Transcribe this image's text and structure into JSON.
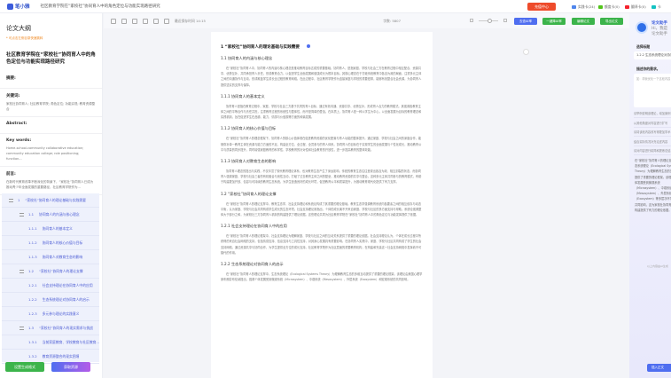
{
  "app": {
    "logo": "笔小雅",
    "doc_title": "社区教育学院在“家校社”协同育人中的角色定位与功能实现路径研究"
  },
  "top": {
    "recharge": "充值中心",
    "badges": [
      {
        "label": "实践卡(24)",
        "color": "#4f86ec"
      },
      {
        "label": "额度卡(0)",
        "color": "#52c41a"
      },
      {
        "label": "翻译卡(0)",
        "color": "#f5222d"
      },
      {
        "label": "卡",
        "color": "#13c2c2"
      }
    ]
  },
  "outline": {
    "title": "论文大纲",
    "hint": "* 可点击左侧目录快速跳转",
    "paper_title": "社区教育学院在“家校社”协同育人中的角色定位与功能实现路径研究",
    "abstract_label": "摘要:",
    "keywords_label": "关键词:",
    "keywords": "家校社协同育人; 社区教育学院; 角色定位; 功能实现; 教育资源整合",
    "abstract_en_label": "Abstract:",
    "keywords_en_label": "Key words:",
    "keywords_en": "Home-school-community collaborative education; community education college; role positioning; function...",
    "intro_label": "前言:",
    "intro": "在新时代教育改革不断深化的背景下，“家校社”协同育人已成为推动青少年全面发展的重要路径，社区教育学院作为...",
    "tree": [
      {
        "num": "1",
        "label": "“家校社”协同育人的理论基础与实践需要",
        "lvl": 1
      },
      {
        "num": "1.1",
        "label": "协同育人的内涵与核心理念",
        "lvl": 2
      },
      {
        "num": "1.1.1",
        "label": "协同育人的基本定义",
        "lvl": 3
      },
      {
        "num": "1.1.2",
        "label": "协同育人的核心价值与目标",
        "lvl": 3
      },
      {
        "num": "1.1.3",
        "label": "协同育人对教育生态的影响",
        "lvl": 3
      },
      {
        "num": "1.2",
        "label": "“家校社”协同育人的理论支撑",
        "lvl": 2
      },
      {
        "num": "1.2.1",
        "label": "社会支持理论在协同育人中的应用",
        "lvl": 3
      },
      {
        "num": "1.2.2",
        "label": "生态系统理论对协同育人的启示",
        "lvl": 3
      },
      {
        "num": "1.2.3",
        "label": "多元参与理论的实践意义",
        "lvl": 3
      },
      {
        "num": "1.3",
        "label": "“家校社”协同育人的现实需求与挑战",
        "lvl": 2
      },
      {
        "num": "1.3.1",
        "label": "当前家庭教育、学校教育与社区教育...",
        "lvl": 3
      },
      {
        "num": "1.3.2",
        "label": "教育资源整合的现实困境",
        "lvl": 3
      }
    ],
    "btn_format": "设置生成格式",
    "btn_resource": "获取资源"
  },
  "toolbar": {
    "saved": "最近保存时间 14:15",
    "wordcount": "字数: 5807",
    "btn_ai": "去查AI率",
    "btn_reduce": "一键降AI率",
    "btn_check": "编辑论文",
    "btn_export": "导出论文"
  },
  "doc": {
    "blocks": [
      {
        "t": "h1",
        "text": "1 “家校社”协同育人的理论基础与实践需要"
      },
      {
        "t": "h3",
        "text": "1.1 协同育人的内涵与核心理念"
      },
      {
        "t": "p",
        "text": "在“家校社”协同育人中，协同育人的内涵与核心理念是推动教育目标达成的重要基础。协同育人，是指家庭、学校与社会三方在教育过程中相互配合、资源共享、优势互补，共同承担育人责任，形成教育合力。以促进学生全面发展和健康成长为根本目标。其核心理念在于打破传统教育中各自为政的局面，注重多元主体之间的沟通协作与互动，形成覆盖学生成长全过程的教育网络。在此过程中，社区教育学院作为连接家庭与学校的重要纽带，能够有效整合社会资源，为协同育人提供坚实的支撑与保障。"
      },
      {
        "t": "h3",
        "text": "1.1.1 协同育人的基本定义"
      },
      {
        "t": "p",
        "text": "协同育人是指在教育过程中，家庭、学校与社会三方基于共同的育人目标，通过有效沟通、资源共享、优势互补，形成育人合力的教育模式。其强调各教育主体之间的平等合作与责任共担，注重教育过程的系统性与整体性，而不是简单的叠加。在本质上，协同育人是一种以学生为中心，以全面发展为目标的教育理念和实践机制，旨在促进学生在品德、能力、情感与价值观等方面的和谐发展。"
      },
      {
        "t": "h3",
        "text": "1.1.2 协同育人的核心价值与目标"
      },
      {
        "t": "p",
        "text": "在“家校社”协同育人的理念框架下，协同育人的核心价值体现在促进教育资源的优化配置与育人功能的整体提升。通过家庭、学校与社会之间的深度合作，能够弥补单一教育主体在资源与能力方面的不足，构建全方位、全过程、全员参与的育人体系。协同育人的目标在于实现学生的全面发展与个性化成长，推动教育公平与质量的同步提升，同时增强家庭教育的科学性、学校教育的针对性和社会教育的开放性，进一步提高教育的整体效能。"
      },
      {
        "t": "h3",
        "text": "1.1.3 协同育人对教育生态的影响"
      },
      {
        "t": "p",
        "text": "协同育人理念的提出与实践，不仅丰富了现代教育理论体系，也对教育生态产生了深远影响。传统的教育生态往往呈现出各自为政、相互割裂的状态，而协同育人强调家庭、学校与社会三者的有机融合与良性互动，打破了过去教育主体之间的壁垒，推动教育资源的共享与整合。这种多元主体共同参与的教育模式，有助于构建更加开放、包容与可持续的教育生态系统，为学生营造良好的成长环境，促进教育公平和质量提升，为推动教育现代化提供了有力支撑。"
      },
      {
        "t": "h3",
        "text": "1.2 “家校社”协同育人的理论支撑"
      },
      {
        "t": "p",
        "text": "在“家校社”协同育人的理论支撑中，教育生态学、社会支持理论和系统论构成了其重要的理论基础。教育生态学强调教育系统内各要素之间的相互依存与动态平衡，认为家庭、学校与社会共同构成学生成长的生态环境。社会支持理论则指出，个体的成长离不开来自家庭、学校与社区的多方面支持与帮助。系统论强调整体大于部分之和，为家校社三方协同育人机制的构建提供了理论依据。这些理论共同为社区教育学院在“家校社”协同育人中的角色定位与功能发挥提供了依据。"
      },
      {
        "t": "h3",
        "text": "1.2.1 社会支持理论在协同育人中的应用"
      },
      {
        "t": "p",
        "text": "在“家校社”协同育人的理论框架中，社会支持理论为理解家庭、学校与社区之间的互动关系提供了重要的理论依据。社会支持理论认为，个体在成长过程中所获得的来自社会网络的支持，包括情感支持、信息支持与工具性支持，对其身心发展具有重要影响。在协同育人实践中，家庭、学校与社区共同构成了学生的社会支持网络，通过资源共享与协同合作，为学生提供全方位的成长支持。社区教育学院作为社区层面的重要教育机构，在构建和完善这一社会支持网络中发挥着不可替代的作用。"
      },
      {
        "t": "h3",
        "text": "1.2.2 生态系统理论对协同育人的启示"
      },
      {
        "t": "p",
        "text": "在“家校社”协同育人的理论支撑中，生态系统理论（Ecological Systems Theory）为理解教育生态的多维互动提供了重要的理论框架。该理论由美国心理学家布朗芬布伦纳提出，强调个体发展受到微观系统（Microsystem）、中观系统（Mesosystem）、外层系统（Exosystem）和宏观系统的共同影响。"
      }
    ]
  },
  "assistant": {
    "name": "论文助手",
    "greeting": "Hi，我是论文助手",
    "section_label": "选择标题",
    "selected": "1.2.2 生态系统理论对协同育人的启示",
    "req_label": "描述你的需求。",
    "placeholder": "如：帮我优化一下这段内容",
    "suggestions": [
      "请举例说明该理论，增加案例",
      "从其他角度对内容进行扩写",
      "请将该段内容改写得更加学术",
      "结合实际情况补充论述内容",
      "请对内容进行精简和提炼总结"
    ],
    "reply": "在“家校社”协同育人的理论支撑中，生态系统理论（Ecological Systems Theory）为理解教育生态的多维互动提供了重要的理论框架。该理论强调个体发展受到微观系统（Microsystem）、中观系统（Mesosystem）、外层系统（Exosystem）等多层次环境系统的共同影响，这为家校社协同育人机制的构建提供了有力的理论依据。",
    "footer": "以上内容由AI生成",
    "insert": "插入正文"
  }
}
